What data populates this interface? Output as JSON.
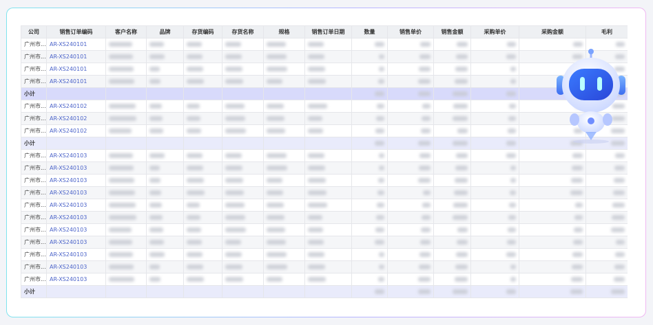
{
  "table": {
    "headers": [
      "公司",
      "销售订单编码",
      "客户名称",
      "品牌",
      "存货编码",
      "存货名称",
      "规格",
      "销售订单日期",
      "数量",
      "销售单价",
      "销售金额",
      "采购单价",
      "采购金额",
      "毛利"
    ],
    "rows": [
      {
        "type": "data",
        "company": "广州市...",
        "order": "AR-XS240101"
      },
      {
        "type": "data",
        "company": "广州市...",
        "order": "AR-XS240101"
      },
      {
        "type": "data",
        "company": "广州市...",
        "order": "AR-XS240101"
      },
      {
        "type": "data",
        "company": "广州市...",
        "order": "AR-XS240101"
      },
      {
        "type": "subtotal",
        "label": "小计",
        "highlight": true
      },
      {
        "type": "data",
        "company": "广州市...",
        "order": "AR-XS240102"
      },
      {
        "type": "data",
        "company": "广州市...",
        "order": "AR-XS240102"
      },
      {
        "type": "data",
        "company": "广州市...",
        "order": "AR-XS240102"
      },
      {
        "type": "subtotal",
        "label": "小计",
        "highlight": false
      },
      {
        "type": "data",
        "company": "广州市...",
        "order": "AR-XS240103"
      },
      {
        "type": "data",
        "company": "广州市...",
        "order": "AR-XS240103"
      },
      {
        "type": "data",
        "company": "广州市...",
        "order": "AR-XS240103"
      },
      {
        "type": "data",
        "company": "广州市...",
        "order": "AR-XS240103"
      },
      {
        "type": "data",
        "company": "广州市...",
        "order": "AR-XS240103"
      },
      {
        "type": "data",
        "company": "广州市...",
        "order": "AR-XS240103"
      },
      {
        "type": "data",
        "company": "广州市...",
        "order": "AR-XS240103"
      },
      {
        "type": "data",
        "company": "广州市...",
        "order": "AR-XS240103"
      },
      {
        "type": "data",
        "company": "广州市...",
        "order": "AR-XS240103"
      },
      {
        "type": "data",
        "company": "广州市...",
        "order": "AR-XS240103"
      },
      {
        "type": "data",
        "company": "广州市...",
        "order": "AR-XS240103"
      },
      {
        "type": "subtotal",
        "label": "小计",
        "highlight": false
      }
    ]
  },
  "mascot": {
    "icon": "robot-assistant-icon"
  },
  "colors": {
    "order_link": "#4b63c9",
    "subtotal_bg": "#e9ebfb",
    "header_bg": "#eef0f3"
  }
}
